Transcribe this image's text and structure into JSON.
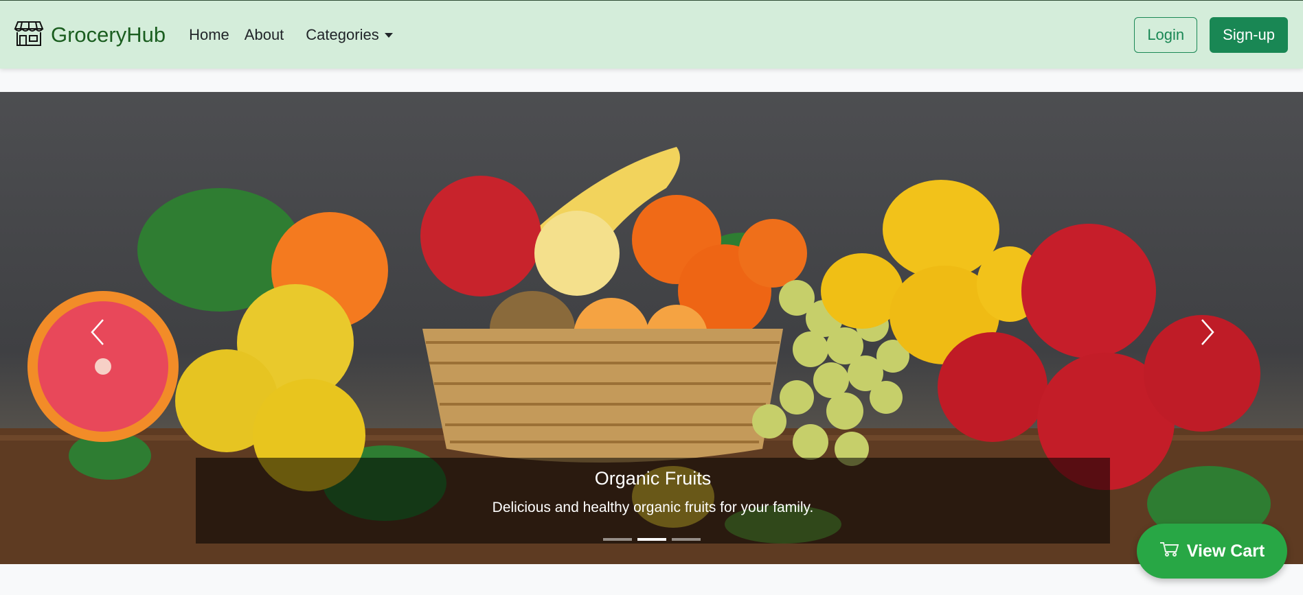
{
  "navbar": {
    "brand": "GroceryHub",
    "links": {
      "home": "Home",
      "about": "About",
      "categories": "Categories"
    },
    "login_label": "Login",
    "signup_label": "Sign-up"
  },
  "carousel": {
    "active_slide": 2,
    "total_slides": 3,
    "caption": {
      "title": "Organic Fruits",
      "text": "Delicious and healthy organic fruits for your family."
    }
  },
  "cart": {
    "label": "View Cart"
  },
  "icons": {
    "brand": "shop-icon",
    "prev": "chevron-left-icon",
    "next": "chevron-right-icon",
    "cart": "cart-icon"
  },
  "colors": {
    "navbar_bg": "#d4edda",
    "brand": "#1b5e20",
    "primary_green": "#198754",
    "cart_green": "#28a745",
    "page_bg": "#f8f9fa"
  }
}
